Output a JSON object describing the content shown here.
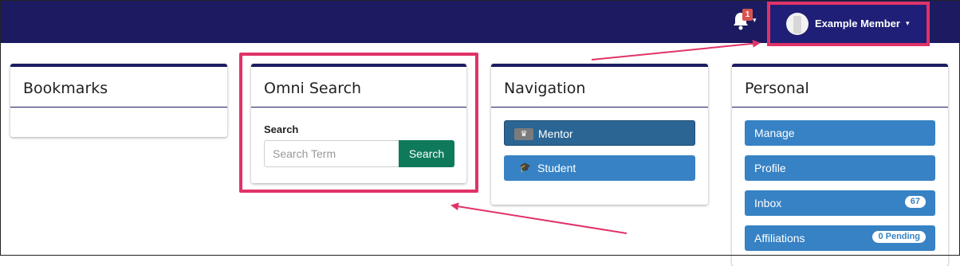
{
  "topbar": {
    "notification_count": "1",
    "member_name": "Example Member"
  },
  "bookmarks": {
    "title": "Bookmarks"
  },
  "omni_search": {
    "title": "Omni Search",
    "search_label": "Search",
    "input_placeholder": "Search Term",
    "search_button": "Search"
  },
  "navigation": {
    "title": "Navigation",
    "items": [
      {
        "label": "Mentor",
        "icon": "mentor-icon"
      },
      {
        "label": "Student",
        "icon": "student-icon"
      }
    ]
  },
  "personal": {
    "title": "Personal",
    "items": [
      {
        "label": "Manage"
      },
      {
        "label": "Profile"
      },
      {
        "label": "Inbox",
        "badge": "67"
      },
      {
        "label": "Affiliations",
        "badge": "0 Pending"
      }
    ]
  },
  "colors": {
    "topbar": "#1c1b62",
    "highlight": "#e03367",
    "primary_button": "#3782c4",
    "search_button": "#0f7a5b"
  }
}
